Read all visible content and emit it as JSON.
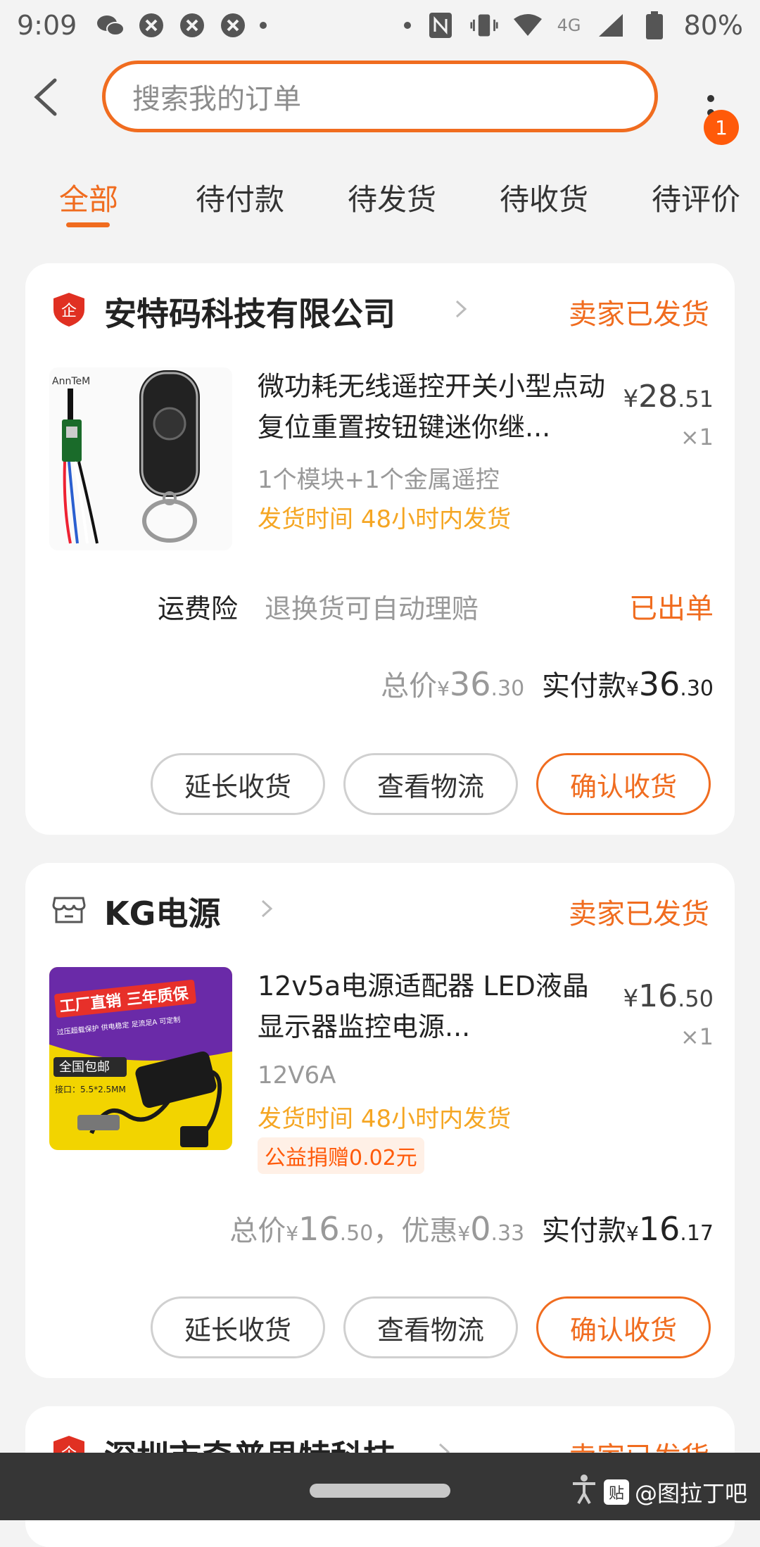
{
  "status_bar": {
    "time": "9:09",
    "network": "4G",
    "battery": "80%"
  },
  "search": {
    "placeholder": "搜索我的订单"
  },
  "more_badge": "1",
  "tabs": [
    {
      "label": "全部",
      "active": true
    },
    {
      "label": "待付款",
      "active": false
    },
    {
      "label": "待发货",
      "active": false
    },
    {
      "label": "待收货",
      "active": false
    },
    {
      "label": "待评价",
      "active": false
    }
  ],
  "orders": [
    {
      "shop_name": "安特码科技有限公司",
      "status": "卖家已发货",
      "product": {
        "title": "微功耗无线遥控开关小型点动复位重置按钮键迷你继...",
        "spec": "1个模块+1个金属遥控",
        "ship_label": "发货时间",
        "ship_time": "48小时内发货",
        "price_int": "28",
        "price_dec": ".51",
        "qty": "×1",
        "image_brand": "AnnTeM"
      },
      "insurance": {
        "label": "运费险",
        "desc": "退换货可自动理赔",
        "status": "已出单"
      },
      "totals": {
        "total_label": "总价",
        "total_int": "36",
        "total_dec": ".30",
        "pay_label": "实付款",
        "pay_int": "36",
        "pay_dec": ".30"
      },
      "buttons": {
        "extend": "延长收货",
        "logistics": "查看物流",
        "confirm": "确认收货"
      }
    },
    {
      "shop_name": "KG电源",
      "status": "卖家已发货",
      "product": {
        "title": "12v5a电源适配器 LED液晶显示器监控电源...",
        "spec": "12V6A",
        "ship_label": "发货时间",
        "ship_time": "48小时内发货",
        "donation": "公益捐赠0.02元",
        "price_int": "16",
        "price_dec": ".50",
        "qty": "×1",
        "image_line1": "工厂直销 三年质保",
        "image_line2": "过压超载保护  供电稳定  足流足A  可定制",
        "image_badge": "全国包邮",
        "image_spec": "接口：5.5*2.5MM"
      },
      "totals": {
        "total_label": "总价",
        "total_int": "16",
        "total_dec": ".50",
        "discount_label": "，优惠",
        "discount_int": "0",
        "discount_dec": ".33",
        "pay_label": "实付款",
        "pay_int": "16",
        "pay_dec": ".17"
      },
      "buttons": {
        "extend": "延长收货",
        "logistics": "查看物流",
        "confirm": "确认收货"
      }
    },
    {
      "shop_name": "深圳市奇普思特科技",
      "status": "卖家已发货"
    }
  ],
  "currency": "¥",
  "watermark": {
    "logo": "贴",
    "text": "@图拉丁吧"
  },
  "colors": {
    "accent": "#f06c1f",
    "ship_time": "#f5a623",
    "badge": "#ff5a0a"
  }
}
